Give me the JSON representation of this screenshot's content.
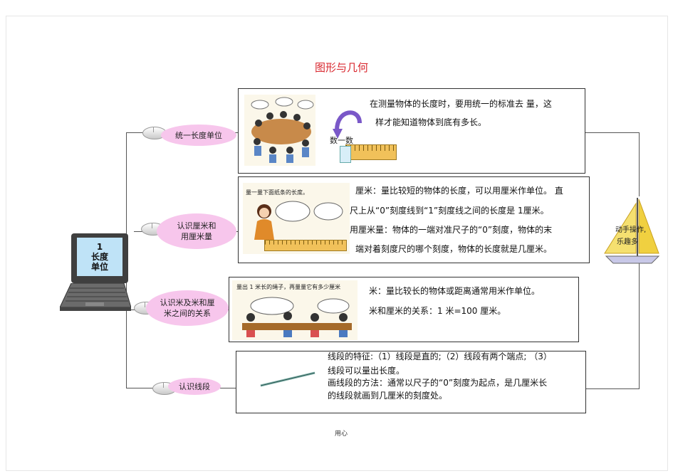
{
  "title": "图形与几何",
  "center": {
    "number": "1",
    "line1": "长度",
    "line2": "单位"
  },
  "branches": [
    {
      "label": "统一长度单位",
      "lines": [
        "在测量物体的长度时，要用统一的标准去  量，这",
        "样才能知道物体到底有多长。"
      ],
      "picture_caption": "数一数"
    },
    {
      "label_line1": "认识厘米和",
      "label_line2": "用厘米量",
      "lines": [
        "厘米：量比较短的物体的长度，可以用厘米作单位。      直",
        "尺上从“0”刻度线到“1”刻度线之间的长度是 1厘米。",
        "用厘米量：物体的一端对准尺子的“0”刻度，物体的末",
        "端对着刻度尺的哪个刻度，物体的长度就是几厘米。"
      ],
      "picture_caption": "量一量下面纸条的长度。"
    },
    {
      "label_line1": "认识米及米和厘",
      "label_line2": "米之间的关系",
      "lines": [
        "米：量比较长的物体或距离通常用米作单位。",
        "米和厘米的关系：1 米=100 厘米。"
      ],
      "picture_caption": "量出 1 米长的绳子，再量量它有多少厘米"
    },
    {
      "label": "认识线段",
      "lines": [
        "线段的特征:（1）线段是直的;（2）线段有两个端点;     （3）",
        "线段可以量出长度。",
        "画线段的方法：通常以尺子的“0”刻度为起点，是几厘米长",
        "的线段就画到几厘米的刻度处。"
      ]
    }
  ],
  "sailboat": {
    "line1": "动手操作,",
    "line2": "乐趣多"
  },
  "footer": "用心"
}
